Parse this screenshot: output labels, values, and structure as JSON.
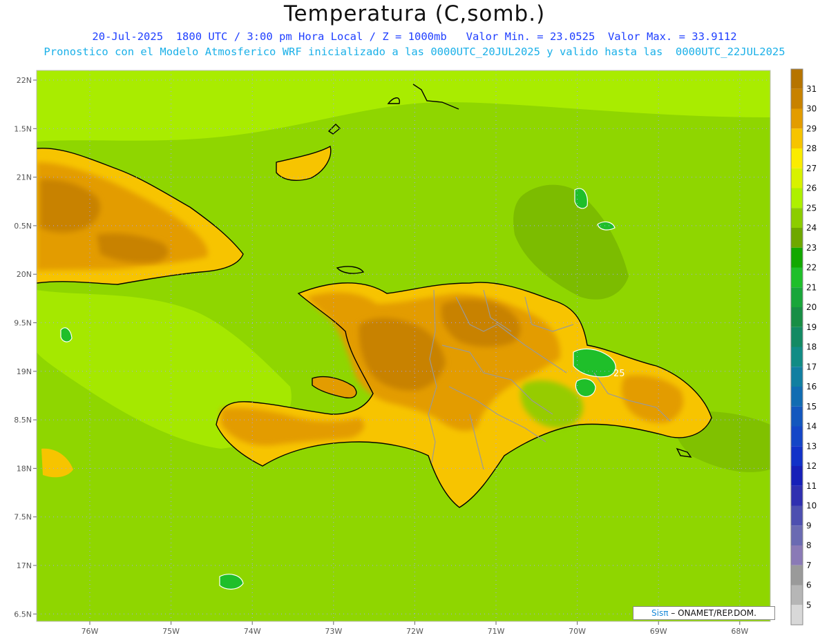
{
  "title": "Temperatura (C,somb.)",
  "subtitle_line1": "20-Jul-2025  1800 UTC / 3:00 pm Hora Local / Z = 1000mb   Valor Min. = 23.0525  Valor Max. = 33.9112",
  "subtitle_line2": "Pronostico con el Modelo Atmosferico WRF inicializado a las 0000UTC_20JUL2025 y valido hasta las  0000UTC_22JUL2025",
  "credit": {
    "brand": "Sisπ",
    "org": " – ONAMET/REP.DOM."
  },
  "axes": {
    "lat_labels": [
      "22N",
      "1.5N",
      "21N",
      "0.5N",
      "20N",
      "9.5N",
      "19N",
      "8.5N",
      "18N",
      "7.5N",
      "17N",
      "6.5N"
    ],
    "lon_labels": [
      "76W",
      "75W",
      "74W",
      "73W",
      "72W",
      "71W",
      "70W",
      "69W",
      "68W"
    ]
  },
  "colorbar": {
    "labels": [
      "31",
      "30",
      "29",
      "28",
      "27",
      "26",
      "25",
      "24",
      "23",
      "22",
      "21",
      "20",
      "19",
      "18",
      "17",
      "16",
      "15",
      "14",
      "13",
      "12",
      "11",
      "10",
      "9",
      "8",
      "7",
      "6",
      "5"
    ],
    "colors": [
      "#c88200",
      "#e39c00",
      "#f7c400",
      "#fbec00",
      "#d8f200",
      "#aef000",
      "#8ccd00",
      "#6ea800",
      "#12a800",
      "#1fbf2a",
      "#19a63a",
      "#188e45",
      "#138a63",
      "#118c85",
      "#117fa1",
      "#116cb2",
      "#1357be",
      "#1446c7",
      "#1232c8",
      "#1720b8",
      "#2f2fb0",
      "#4d4fb0",
      "#6a6ab2",
      "#8a7ab6",
      "#9a9a9a",
      "#b6b6b6",
      "#d8d8d8"
    ]
  },
  "contour_label": "25",
  "colors": {
    "sea_base": "#8fd600",
    "land_hot": "#e39c00",
    "land_hottest": "#c88200",
    "warm_yellow": "#f7c400",
    "coast": "#000000",
    "borders": "#9a9a9a",
    "grid": "#a0a0ff"
  }
}
